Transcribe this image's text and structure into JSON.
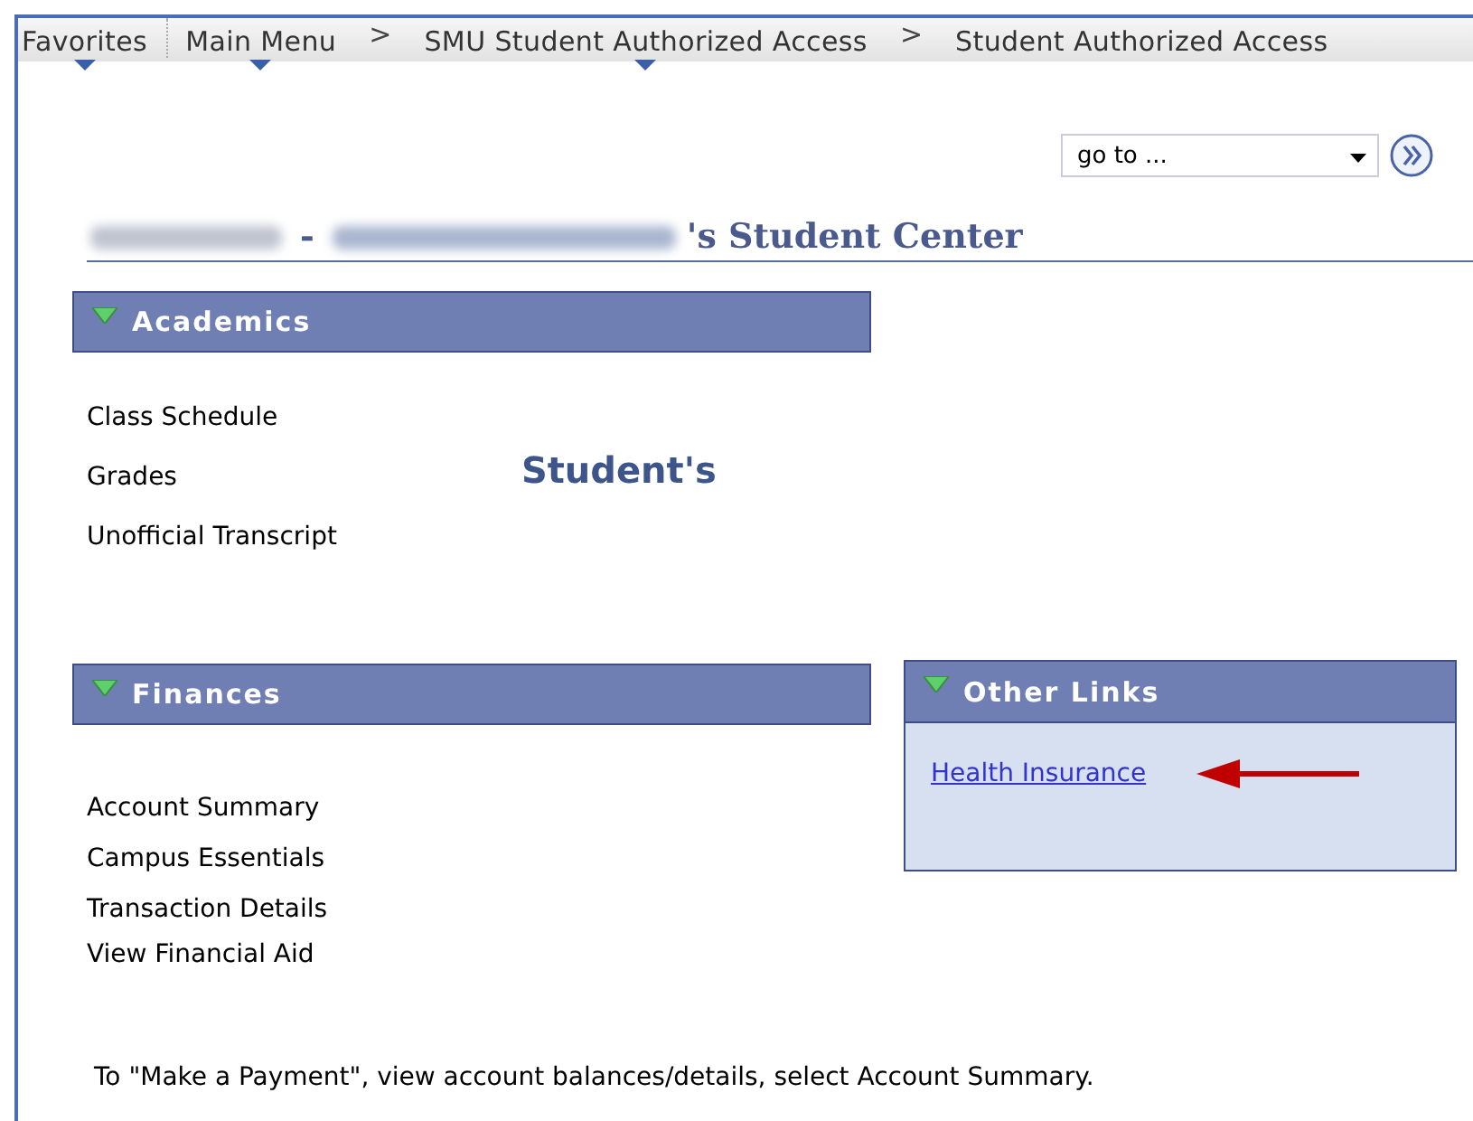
{
  "nav": [
    {
      "label": "Favorites",
      "menu": true
    },
    {
      "label": "Main Menu",
      "menu": true
    },
    {
      "label": "SMU Student Authorized Access",
      "menu": true,
      "separator": ">"
    },
    {
      "label": "Student Authorized Access",
      "menu": false,
      "separator": ">"
    }
  ],
  "goto": {
    "value": "go to ..."
  },
  "title": {
    "separator": "-",
    "suffix": "'s Student Center"
  },
  "academics": {
    "title": "Academics",
    "expanded": true,
    "links": [
      "Class Schedule",
      "Grades",
      "Unofficial Transcript"
    ],
    "note": "Student's"
  },
  "finances": {
    "title": "Finances",
    "expanded": true,
    "links": [
      "Account Summary",
      "Campus Essentials",
      "Transaction Details",
      "View Financial Aid"
    ]
  },
  "other_links": {
    "title": "Other Links",
    "expanded": true,
    "links": [
      "Health Insurance"
    ]
  },
  "footer": "To \"Make a Payment\", view account balances/details, select Account Summary."
}
